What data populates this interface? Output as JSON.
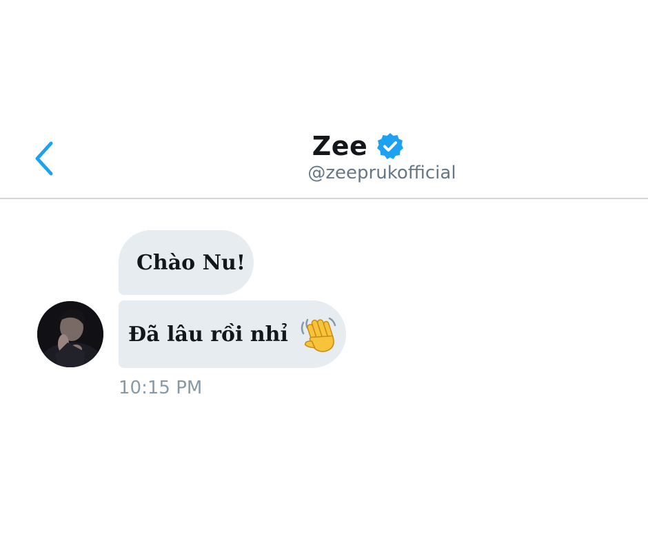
{
  "header": {
    "display_name": "Zee",
    "handle": "@zeeprukofficial",
    "verified": true,
    "back_icon": "chevron-left-icon",
    "verified_icon": "verified-badge-icon"
  },
  "conversation": {
    "messages": [
      {
        "text": "Chào Nu!"
      },
      {
        "text": "Đã lâu rồi nhỉ",
        "emoji": "waving-hand-icon"
      }
    ],
    "timestamp": "10:15 PM"
  },
  "colors": {
    "accent": "#1da1f2",
    "bubble": "#e6ecf0",
    "text": "#14171a",
    "secondary_text": "#657786",
    "divider": "#d3d6d9"
  }
}
